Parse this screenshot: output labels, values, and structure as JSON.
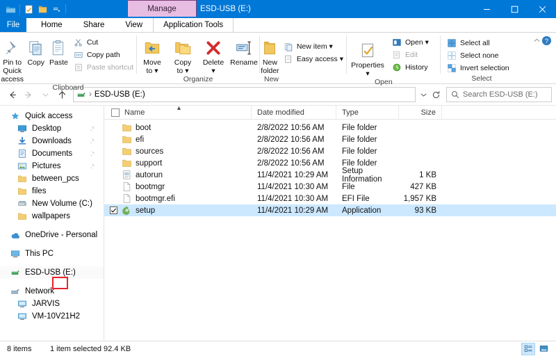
{
  "window": {
    "title": "ESD-USB (E:)",
    "manage_tab_header": "Manage",
    "quick_access_icons": [
      "explorer-icon",
      "properties-icon",
      "new-folder-icon",
      "customize-qat-icon"
    ],
    "controls": {
      "minimize": "minimize-icon",
      "maximize": "maximize-icon",
      "close": "close-icon"
    }
  },
  "ribbon": {
    "tabs": [
      {
        "label": "File",
        "id": "file"
      },
      {
        "label": "Home",
        "id": "home"
      },
      {
        "label": "Share",
        "id": "share"
      },
      {
        "label": "View",
        "id": "view"
      },
      {
        "label": "Application Tools",
        "id": "application-tools"
      }
    ],
    "active_tab": "Home",
    "help_icon": "help-icon",
    "collapse_icon": "collapse-ribbon-icon",
    "groups": [
      {
        "name": "Clipboard",
        "big": [
          {
            "label": "Pin to Quick\naccess",
            "line1": "Pin to Quick",
            "line2": "access",
            "icon": "pin-icon"
          },
          {
            "label": "Copy",
            "line1": "Copy",
            "line2": "",
            "icon": "copy-icon"
          },
          {
            "label": "Paste",
            "line1": "Paste",
            "line2": "",
            "icon": "paste-icon"
          }
        ],
        "small": [
          {
            "label": "Cut",
            "icon": "scissors-icon",
            "disabled": false
          },
          {
            "label": "Copy path",
            "icon": "copy-path-icon",
            "disabled": false
          },
          {
            "label": "Paste shortcut",
            "icon": "paste-shortcut-icon",
            "disabled": true
          }
        ]
      },
      {
        "name": "Organize",
        "big": [
          {
            "line1": "Move",
            "line2": "to",
            "icon": "move-to-icon",
            "dropdown": true
          },
          {
            "line1": "Copy",
            "line2": "to",
            "icon": "copy-to-icon",
            "dropdown": true
          },
          {
            "line1": "Delete",
            "line2": "",
            "icon": "delete-icon",
            "dropdown": true
          },
          {
            "line1": "Rename",
            "line2": "",
            "icon": "rename-icon",
            "dropdown": false
          }
        ]
      },
      {
        "name": "New",
        "big": [
          {
            "line1": "New",
            "line2": "folder",
            "icon": "new-folder-icon",
            "dropdown": false
          }
        ],
        "small": [
          {
            "label": "New item",
            "icon": "new-item-icon",
            "dropdown": true
          },
          {
            "label": "Easy access",
            "icon": "easy-access-icon",
            "dropdown": true
          }
        ]
      },
      {
        "name": "Open",
        "big": [
          {
            "line1": "Properties",
            "line2": "",
            "icon": "properties-icon",
            "dropdown": true
          }
        ],
        "small": [
          {
            "label": "Open",
            "icon": "open-icon",
            "dropdown": true,
            "disabled": false
          },
          {
            "label": "Edit",
            "icon": "edit-icon",
            "disabled": true
          },
          {
            "label": "History",
            "icon": "history-icon",
            "disabled": false
          }
        ]
      },
      {
        "name": "Select",
        "small": [
          {
            "label": "Select all",
            "icon": "select-all-icon"
          },
          {
            "label": "Select none",
            "icon": "select-none-icon"
          },
          {
            "label": "Invert selection",
            "icon": "invert-selection-icon"
          }
        ]
      }
    ]
  },
  "address": {
    "back_icon": "back-arrow-icon",
    "forward_icon": "forward-arrow-icon",
    "recent_icon": "recent-locations-icon",
    "up_icon": "up-arrow-icon",
    "drive_icon": "usb-drive-icon",
    "path": "ESD-USB (E:)",
    "separator": "›",
    "dropdown_icon": "address-dropdown-icon",
    "refresh_icon": "refresh-icon"
  },
  "search": {
    "icon": "search-icon",
    "placeholder": "Search ESD-USB (E:)",
    "value": ""
  },
  "sidebar": {
    "items": [
      {
        "label": "Quick access",
        "icon": "star-icon",
        "indent": false,
        "pinned": false
      },
      {
        "label": "Desktop",
        "icon": "desktop-icon",
        "indent": true,
        "pinned": true
      },
      {
        "label": "Downloads",
        "icon": "downloads-icon",
        "indent": true,
        "pinned": true
      },
      {
        "label": "Documents",
        "icon": "documents-icon",
        "indent": true,
        "pinned": true
      },
      {
        "label": "Pictures",
        "icon": "pictures-icon",
        "indent": true,
        "pinned": true
      },
      {
        "label": "between_pcs",
        "icon": "folder-icon",
        "indent": true,
        "pinned": false
      },
      {
        "label": "files",
        "icon": "folder-icon",
        "indent": true,
        "pinned": false
      },
      {
        "label": "New Volume (C:)",
        "icon": "drive-icon",
        "indent": true,
        "pinned": false
      },
      {
        "label": "wallpapers",
        "icon": "folder-icon",
        "indent": true,
        "pinned": false
      },
      {
        "label": "OneDrive - Personal",
        "icon": "onedrive-icon",
        "indent": false,
        "pinned": false,
        "gap_before": true
      },
      {
        "label": "This PC",
        "icon": "this-pc-icon",
        "indent": false,
        "pinned": false,
        "gap_before": true
      },
      {
        "label": "ESD-USB (E:)",
        "icon": "usb-drive-icon",
        "indent": false,
        "pinned": false,
        "gap_before": true,
        "highlighted": true
      },
      {
        "label": "Network",
        "icon": "network-icon",
        "indent": false,
        "pinned": false,
        "gap_before": true
      },
      {
        "label": "JARVIS",
        "icon": "computer-icon",
        "indent": true,
        "pinned": false
      },
      {
        "label": "VM-10V21H2",
        "icon": "computer-icon",
        "indent": true,
        "pinned": false
      }
    ]
  },
  "filelist": {
    "columns": [
      {
        "label": "Name",
        "key": "name"
      },
      {
        "label": "Date modified",
        "key": "date"
      },
      {
        "label": "Type",
        "key": "type"
      },
      {
        "label": "Size",
        "key": "size"
      }
    ],
    "sort_column": "Name",
    "sort_direction": "ascending",
    "select_all_checkbox": false,
    "rows": [
      {
        "name": "boot",
        "date": "2/8/2022 10:56 AM",
        "type": "File folder",
        "size": "",
        "icon": "folder-icon",
        "selected": false
      },
      {
        "name": "efi",
        "date": "2/8/2022 10:56 AM",
        "type": "File folder",
        "size": "",
        "icon": "folder-icon",
        "selected": false
      },
      {
        "name": "sources",
        "date": "2/8/2022 10:56 AM",
        "type": "File folder",
        "size": "",
        "icon": "folder-icon",
        "selected": false
      },
      {
        "name": "support",
        "date": "2/8/2022 10:56 AM",
        "type": "File folder",
        "size": "",
        "icon": "folder-icon",
        "selected": false
      },
      {
        "name": "autorun",
        "date": "11/4/2021 10:29 AM",
        "type": "Setup Information",
        "size": "1 KB",
        "icon": "setup-info-icon",
        "selected": false
      },
      {
        "name": "bootmgr",
        "date": "11/4/2021 10:30 AM",
        "type": "File",
        "size": "427 KB",
        "icon": "file-icon",
        "selected": false
      },
      {
        "name": "bootmgr.efi",
        "date": "11/4/2021 10:30 AM",
        "type": "EFI File",
        "size": "1,957 KB",
        "icon": "file-icon",
        "selected": false
      },
      {
        "name": "setup",
        "date": "11/4/2021 10:29 AM",
        "type": "Application",
        "size": "93 KB",
        "icon": "application-icon",
        "selected": true
      }
    ]
  },
  "status": {
    "item_count": "8 items",
    "selection": "1 item selected  92.4 KB",
    "details_view_icon": "details-view-icon",
    "large_icons_view_icon": "large-icons-view-icon",
    "active_view": "details"
  },
  "annotation": {
    "type": "red-highlight-box",
    "target": "(E:)",
    "color": "#e8232a"
  }
}
